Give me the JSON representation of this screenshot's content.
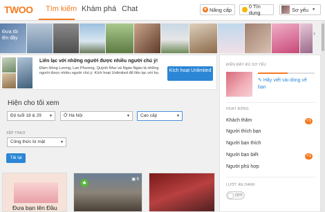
{
  "brand": {
    "logo": "TWOO"
  },
  "nav": {
    "tabs": [
      "Tìm kiếm",
      "Khám phá",
      "Chat"
    ]
  },
  "header": {
    "upgrade_label": "Nâng cấp",
    "credits_label": "0 Tín dụng",
    "user_name": "Sơ yếu"
  },
  "strip": {
    "promo_label": "Đưa tôi lên đây"
  },
  "unlimited": {
    "title": "Liên lạc với những người được nhiều người chú ý!",
    "text": "Đàm Hồng Lương, Lan Phương, Quỳnh Như và Ngào Ngào là những người được nhiều người chú ý. Kích hoạt Unlimited để liên lạc với họ.",
    "button_label": "Kích hoạt Unlimited"
  },
  "filters": {
    "title": "Hiện cho tôi xem",
    "age": "Độ tuổi 18 & 29",
    "location": "Ở Hà Nội",
    "level": "Cao cấp",
    "sort_label": "XẾP THEO",
    "sort_value": "Công thức bí mật",
    "reload_label": "Tải lại"
  },
  "cards": {
    "promo_label": "Đưa bạn lên Đầu",
    "photo_count": "6"
  },
  "sidebar": {
    "profile_label": "ĐIỀN ĐẦY ĐỦ SƠ YẾU",
    "profile_progress": 0.53,
    "profile_link": "Hãy viết vài dòng về bạn",
    "activity_label": "HOẠT ĐỘNG",
    "items": [
      {
        "label": "Khách thăm",
        "badge": "+1"
      },
      {
        "label": "Người thích bạn",
        "badge": ""
      },
      {
        "label": "Người bạn thích",
        "badge": ""
      },
      {
        "label": "Người bạn biết",
        "badge": "+1"
      },
      {
        "label": "Người phù hợp",
        "badge": ""
      }
    ],
    "incognito_label": "LƯỚT ẨN DANH",
    "toggle_label": "OFF"
  },
  "colors": {
    "accent": "#f47a20",
    "button": "#2b86d6"
  }
}
